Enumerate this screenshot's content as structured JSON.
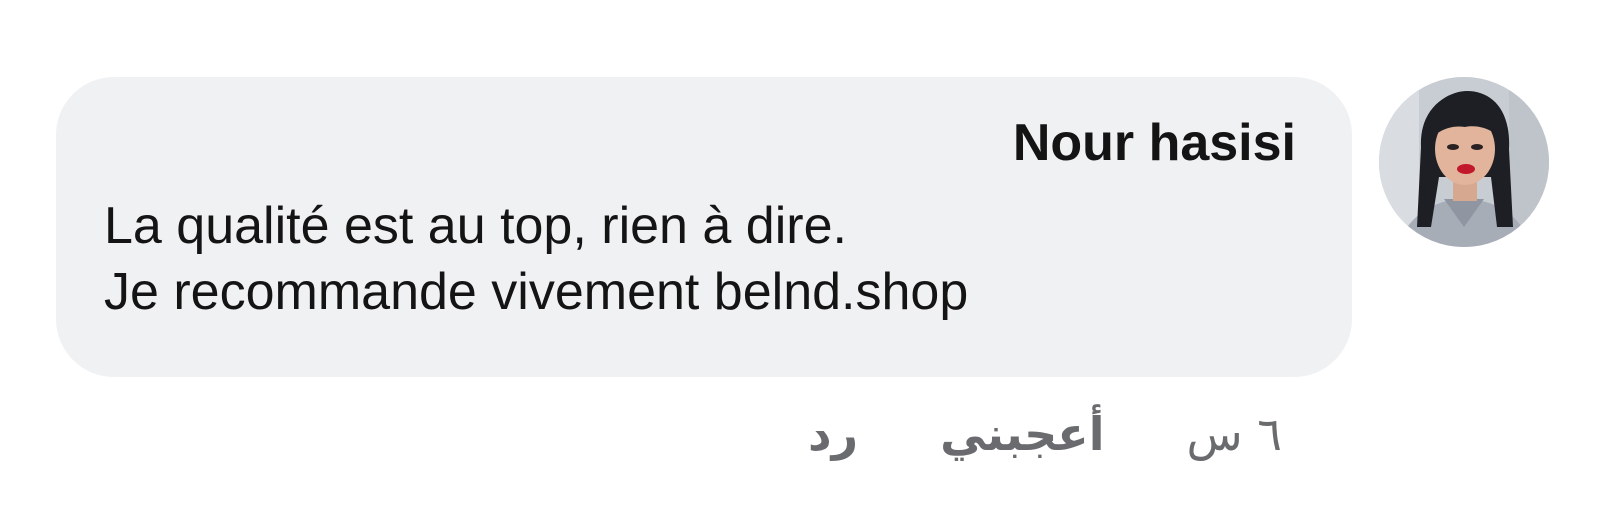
{
  "comment": {
    "author": "Nour hasisi",
    "text_lines": [
      "La qualité est au top, rien à dire.",
      "Je recommande vivement belnd.shop"
    ],
    "timestamp": "٦ س",
    "like_label": "أعجبني",
    "reply_label": "رد"
  },
  "colors": {
    "bubble_background": "#f0f1f3",
    "text": "#141414",
    "meta_text": "#6a6b6e"
  }
}
